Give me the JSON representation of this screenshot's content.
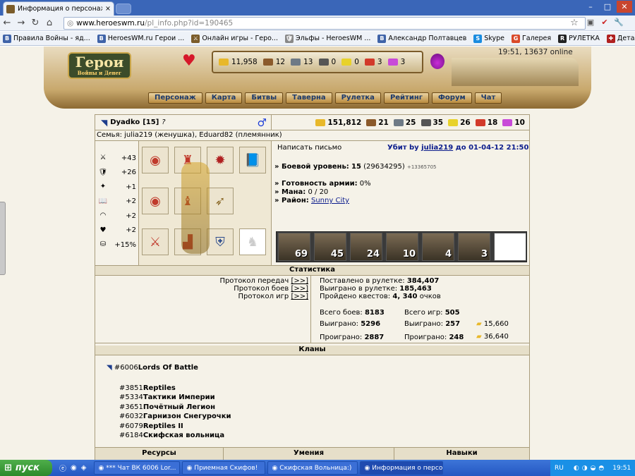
{
  "browser": {
    "tab_title": "Информация о персонаже.",
    "close_symbol": "×",
    "url_host": "www.heroeswm.ru",
    "url_path": "/pl_info.php?id=190465",
    "bookmarks": [
      {
        "label": "Правила Войны - яд...",
        "icon": "B",
        "color": "#3f63a8"
      },
      {
        "label": "HeroesWM.ru Герои ...",
        "icon": "B",
        "color": "#3f63a8"
      },
      {
        "label": "Онлайн игры - Геро...",
        "icon": "⚔",
        "color": "#7b5c2a"
      },
      {
        "label": "Эльфы - HeroesWM ...",
        "icon": "🛡",
        "color": "#888"
      },
      {
        "label": "Александр Полтавцев",
        "icon": "B",
        "color": "#3f63a8"
      },
      {
        "label": "Skype",
        "icon": "S",
        "color": "#1a8ce0"
      },
      {
        "label": "Галерея",
        "icon": "G",
        "color": "#d94a2a"
      },
      {
        "label": "РУЛЕТКА",
        "icon": "R",
        "color": "#222"
      },
      {
        "label": "Детальная Статист...",
        "icon": "✚",
        "color": "#b02020"
      }
    ]
  },
  "game_header": {
    "logo_title": "Герои",
    "logo_subtitle": "Войны и Денег",
    "time_online": "19:51, 13637 online",
    "resources": [
      {
        "name": "gold",
        "value": "11,958",
        "color": "#e8b82a"
      },
      {
        "name": "wood",
        "value": "12",
        "color": "#8b5a2b"
      },
      {
        "name": "ore",
        "value": "13",
        "color": "#6e7a86"
      },
      {
        "name": "mercury",
        "value": "0",
        "color": "#555"
      },
      {
        "name": "sulfur",
        "value": "0",
        "color": "#e8d22a"
      },
      {
        "name": "crystals",
        "value": "3",
        "color": "#d23a2a"
      },
      {
        "name": "gems",
        "value": "3",
        "color": "#c84ad8"
      }
    ],
    "menu": [
      "Персонаж",
      "Карта",
      "Битвы",
      "Таверна",
      "Рулетка",
      "Рейтинг",
      "Форум",
      "Чат"
    ]
  },
  "player": {
    "name": "Dyadko",
    "level_bracket": "[15]",
    "help_symbol": "?",
    "gender_symbol": "♂",
    "family": "Семья: julia219 (женушка), Eduard82 (племянник)",
    "resources": [
      {
        "name": "gold",
        "value": "151,812",
        "color": "#e8b82a"
      },
      {
        "name": "wood",
        "value": "21",
        "color": "#8b5a2b"
      },
      {
        "name": "ore",
        "value": "25",
        "color": "#6e7a86"
      },
      {
        "name": "mercury",
        "value": "35",
        "color": "#555"
      },
      {
        "name": "sulfur",
        "value": "26",
        "color": "#e8d22a"
      },
      {
        "name": "crystals",
        "value": "18",
        "color": "#d23a2a"
      },
      {
        "name": "gems",
        "value": "10",
        "color": "#c84ad8"
      }
    ],
    "stats": [
      {
        "icon": "⚔",
        "value": "+43"
      },
      {
        "icon": "🛡",
        "value": "+26"
      },
      {
        "icon": "✦",
        "value": "+1"
      },
      {
        "icon": "📖",
        "value": "+2"
      },
      {
        "icon": "◠",
        "value": "+2"
      },
      {
        "icon": "♥",
        "value": "+2"
      },
      {
        "icon": "⛁",
        "value": "+15%"
      }
    ],
    "write_letter": "Написать письмо",
    "killed_by_prefix": "Убит by",
    "killed_by_name": "julia219",
    "killed_by_suffix": "до 01-04-12 21:50",
    "combat_level_label": "» Боевой уровень:",
    "combat_level_value": "15",
    "combat_level_exp": "(29634295)",
    "combat_level_next": "+13365705",
    "army_ready_label": "» Готовность армии:",
    "army_ready_value": "0%",
    "mana_label": "» Мана:",
    "mana_value": "0 / 20",
    "district_label": "» Район:",
    "district_value": "Sunny City",
    "units": [
      "69",
      "45",
      "24",
      "10",
      "4",
      "3",
      ""
    ]
  },
  "statistics": {
    "title": "Статистика",
    "protocols": [
      {
        "label": "Протокол передач",
        "link": "[>>]"
      },
      {
        "label": "Протокол боев",
        "link": "[>>]"
      },
      {
        "label": "Протокол игр",
        "link": "[>>]"
      }
    ],
    "roulette_bet_label": "Поставлено в рулетке:",
    "roulette_bet_value": "384,407",
    "roulette_won_label": "Выиграно в рулетке:",
    "roulette_won_value": "185,463",
    "quests_label": "Пройдено квестов:",
    "quests_value": "4, 340",
    "quests_unit": "очков",
    "battles_total_label": "Всего боев:",
    "battles_total_value": "8183",
    "battles_won_label": "Выиграно:",
    "battles_won_value": "5296",
    "battles_lost_label": "Проиграно:",
    "battles_lost_value": "2887",
    "games_total_label": "Всего игр:",
    "games_total_value": "505",
    "games_won_label": "Выиграно:",
    "games_won_value": "257",
    "games_lost_label": "Проиграно:",
    "games_lost_value": "248",
    "gold_won": "15,660",
    "gold_lost": "36,640"
  },
  "clans": {
    "title": "Кланы",
    "main": {
      "id": "#6006",
      "name": "Lords Of Battle"
    },
    "list": [
      {
        "id": "#3851",
        "name": "Reptiles"
      },
      {
        "id": "#5334",
        "name": "Тактики Империи"
      },
      {
        "id": "#3651",
        "name": "Почётный Легион"
      },
      {
        "id": "#6032",
        "name": "Гарнизон Снегурочки"
      },
      {
        "id": "#6079",
        "name": "Reptiles II"
      },
      {
        "id": "#6184",
        "name": "Скифская вольница"
      }
    ]
  },
  "bottom_headers": [
    "Ресурсы",
    "Умения",
    "Навыки"
  ],
  "taskbar": {
    "start": "пуск",
    "items": [
      "*** Чат ВК 6006 Lor...",
      "Приемная Скифов!",
      "Скифская Вольница:)",
      "Информация о персо..."
    ],
    "lang": "RU",
    "clock": "19:51"
  }
}
